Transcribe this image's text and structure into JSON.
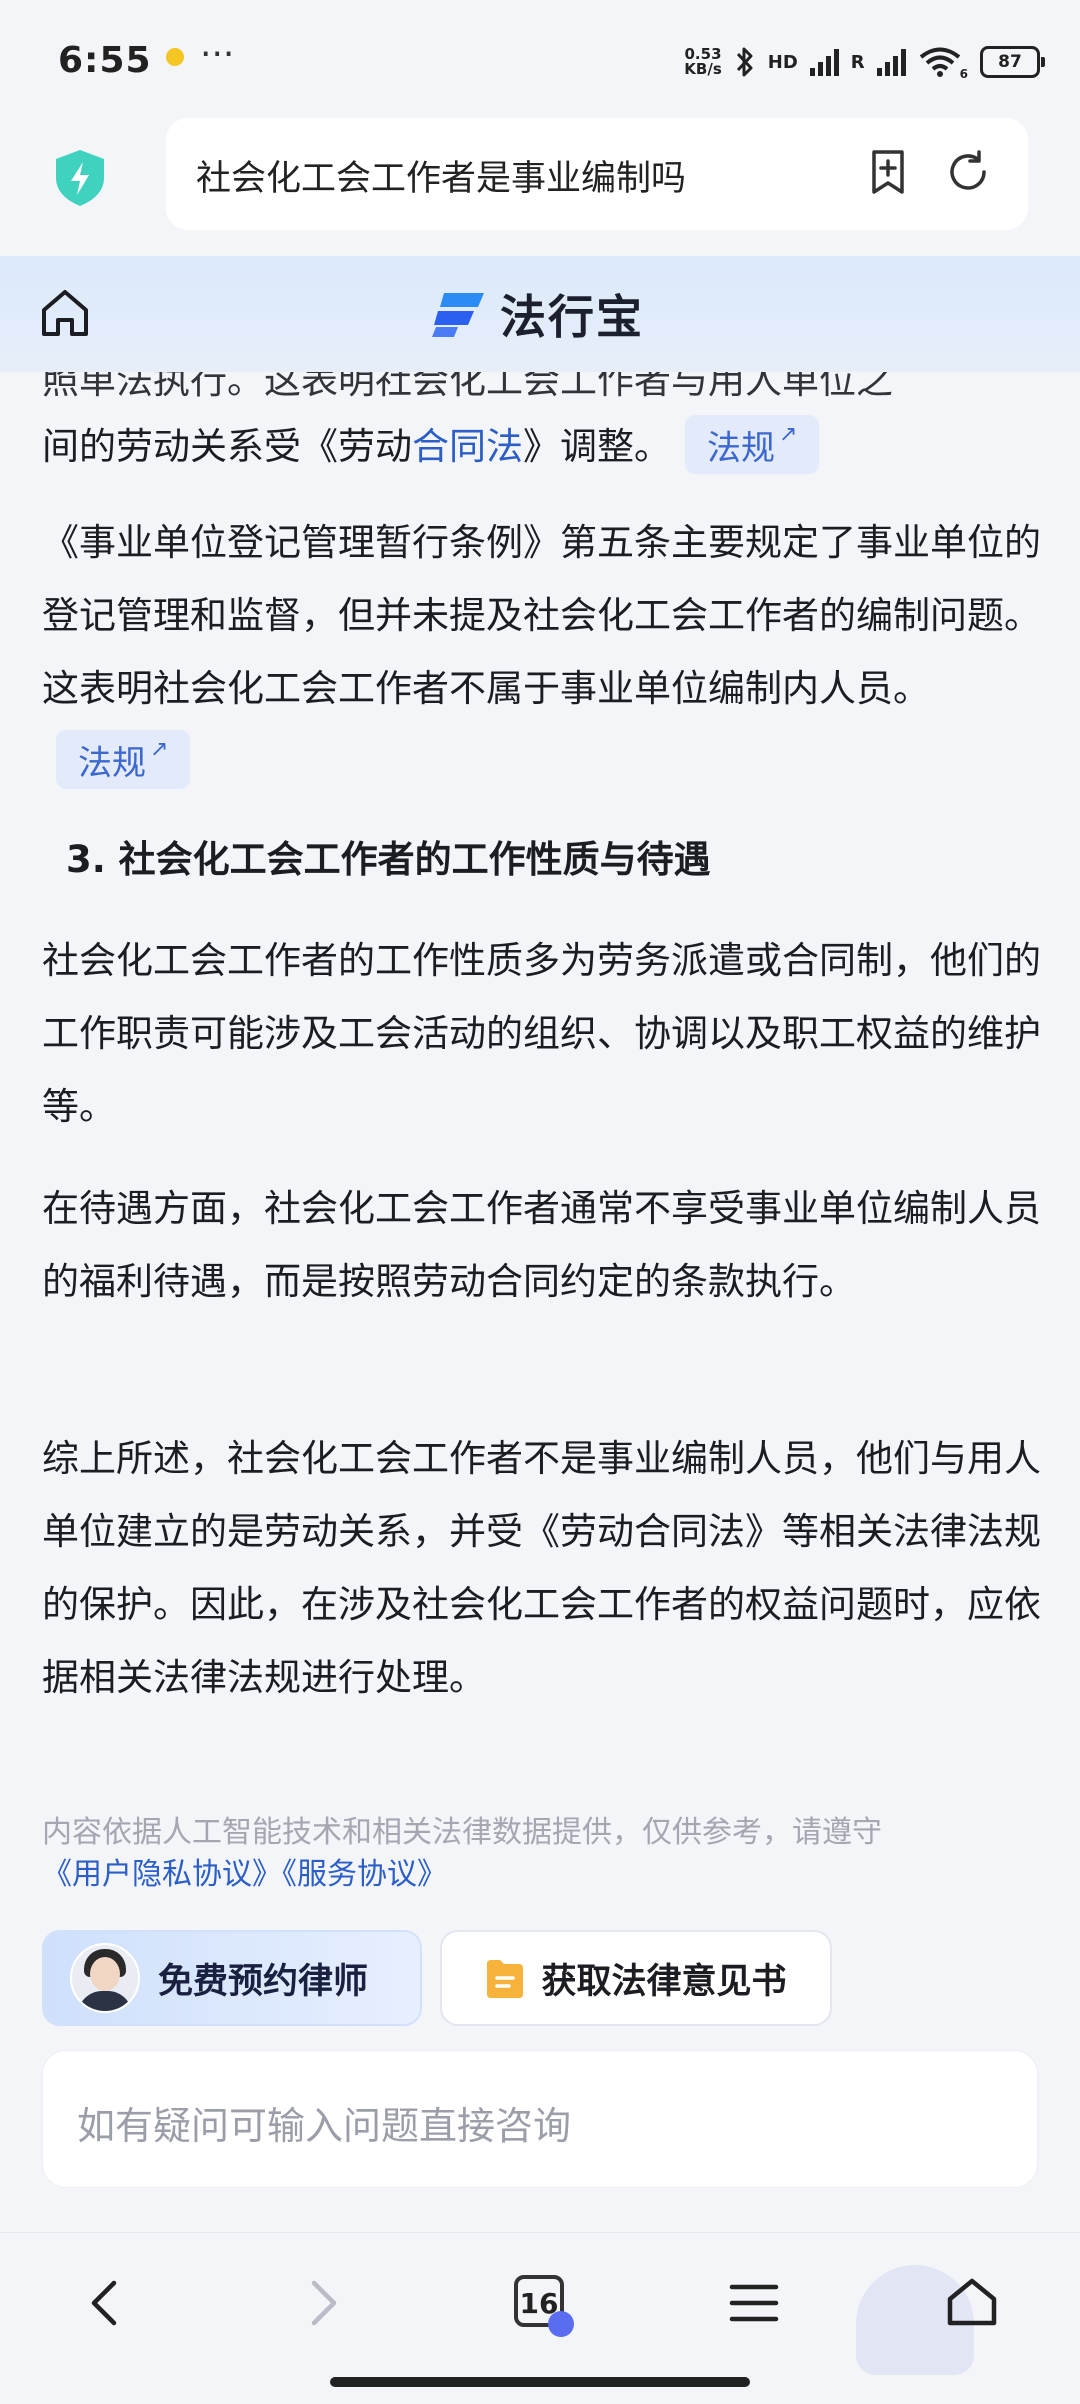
{
  "status_bar": {
    "time": "6:55",
    "dots": "···",
    "net_speed_value": "0.53",
    "net_speed_unit": "KB/s",
    "hd_label": "HD",
    "r_label": "R",
    "wifi_label": "6",
    "battery": "87"
  },
  "address_bar": {
    "query": "社会化工会工作者是事业编制吗"
  },
  "site": {
    "logo_text": "法行宝",
    "brand_color": "#2b6cf0"
  },
  "article": {
    "partial_top_line": "照单法执行。这表明社会化工会工作者与用人单位之",
    "para1_prefix": "间的劳动关系受《劳动",
    "para1_link": "合同法",
    "para1_suffix": "》调整。",
    "para2": "《事业单位登记管理暂行条例》第五条主要规定了事业单位的登记管理和监督，但并未提及社会化工会工作者的编制问题。这表明社会化工会工作者不属于事业单位编制内人员。",
    "tag_label": "法规",
    "heading3": "3. 社会化工会工作者的工作性质与待遇",
    "para3": "社会化工会工作者的工作性质多为劳务派遣或合同制，他们的工作职责可能涉及工会活动的组织、协调以及职工权益的维护等。",
    "para4": "在待遇方面，社会化工会工作者通常不享受事业单位编制人员的福利待遇，而是按照劳动合同约定的条款执行。",
    "para5": "综上所述，社会化工会工作者不是事业编制人员，他们与用人单位建立的是劳动关系，并受《劳动合同法》等相关法律法规的保护。因此，在涉及社会化工会工作者的权益问题时，应依据相关法律法规进行处理。"
  },
  "disclaimer": {
    "text": "内容依据人工智能技术和相关法律数据提供，仅供参考，请遵守",
    "privacy_link": "《用户隐私协议》",
    "service_link": "《服务协议》"
  },
  "actions": {
    "lawyer_button": "免费预约律师",
    "opinion_button": "获取法律意见书"
  },
  "chat_input": {
    "placeholder": "如有疑问可输入问题直接咨询"
  },
  "bottom_nav": {
    "tab_count": "16"
  }
}
